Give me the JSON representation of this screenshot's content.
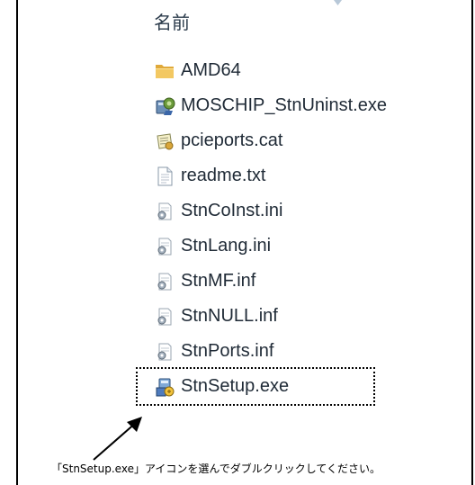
{
  "header": {
    "column_name": "名前"
  },
  "files": [
    {
      "name": "AMD64",
      "icon": "folder-icon",
      "selected": false
    },
    {
      "name": "MOSCHIP_StnUninst.exe",
      "icon": "setup-exe-icon",
      "selected": false
    },
    {
      "name": "pcieports.cat",
      "icon": "security-catalog-icon",
      "selected": false
    },
    {
      "name": "readme.txt",
      "icon": "text-file-icon",
      "selected": false
    },
    {
      "name": "StnCoInst.ini",
      "icon": "config-file-icon",
      "selected": false
    },
    {
      "name": "StnLang.ini",
      "icon": "config-file-icon",
      "selected": false
    },
    {
      "name": "StnMF.inf",
      "icon": "setup-info-file-icon",
      "selected": false
    },
    {
      "name": "StnNULL.inf",
      "icon": "setup-info-file-icon",
      "selected": false
    },
    {
      "name": "StnPorts.inf",
      "icon": "setup-info-file-icon",
      "selected": false
    },
    {
      "name": "StnSetup.exe",
      "icon": "installer-exe-icon",
      "selected": true
    }
  ],
  "annotation": {
    "caption": "「StnSetup.exe」アイコンを選んでダブルクリックしてください。"
  },
  "colors": {
    "folder": "#e8b84a",
    "text": "#1f2a36",
    "selection_outline": "#000000"
  }
}
